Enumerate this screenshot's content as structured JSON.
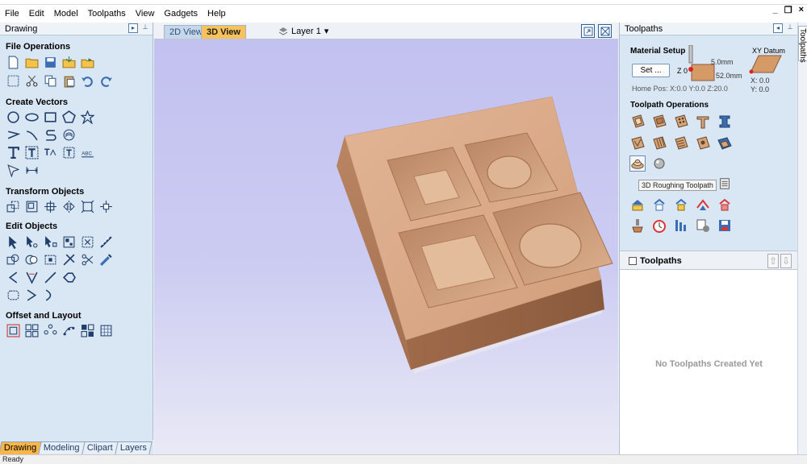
{
  "menu": [
    "File",
    "Edit",
    "Model",
    "Toolpaths",
    "View",
    "Gadgets",
    "Help"
  ],
  "window_controls": [
    "_",
    "❐",
    "×"
  ],
  "left_panel": {
    "title": "Drawing",
    "sections": {
      "file_operations": "File Operations",
      "create_vectors": "Create Vectors",
      "transform_objects": "Transform Objects",
      "edit_objects": "Edit Objects",
      "offset_and_layout": "Offset and Layout"
    },
    "bottom_tabs": [
      "Drawing",
      "Modeling",
      "Clipart",
      "Layers"
    ]
  },
  "view": {
    "tab_2d": "2D View",
    "tab_3d": "3D View",
    "layer": "Layer 1"
  },
  "right_panel": {
    "title": "Toolpaths",
    "rail_tab": "Toolpaths",
    "material_setup": "Material Setup",
    "set_button": "Set ...",
    "z0": "Z 0",
    "dim_top": "5.0mm",
    "dim_thickness": "52.0mm",
    "home_pos": "Home Pos:  X:0.0 Y:0.0 Z:20.0",
    "xy_datum": "XY Datum",
    "x_val": "X: 0.0",
    "y_val": "Y: 0.0",
    "toolpath_operations": "Toolpath Operations",
    "tooltip": "3D Roughing Toolpath",
    "toolpaths_list_label": "Toolpaths",
    "empty_message": "No Toolpaths Created Yet"
  },
  "status": "Ready",
  "colors": {
    "panel_bg": "#d9e7f4",
    "active_tab": "#f7b54a",
    "viewport_bg": "#c2c1f0",
    "wood": "#d9a886"
  }
}
